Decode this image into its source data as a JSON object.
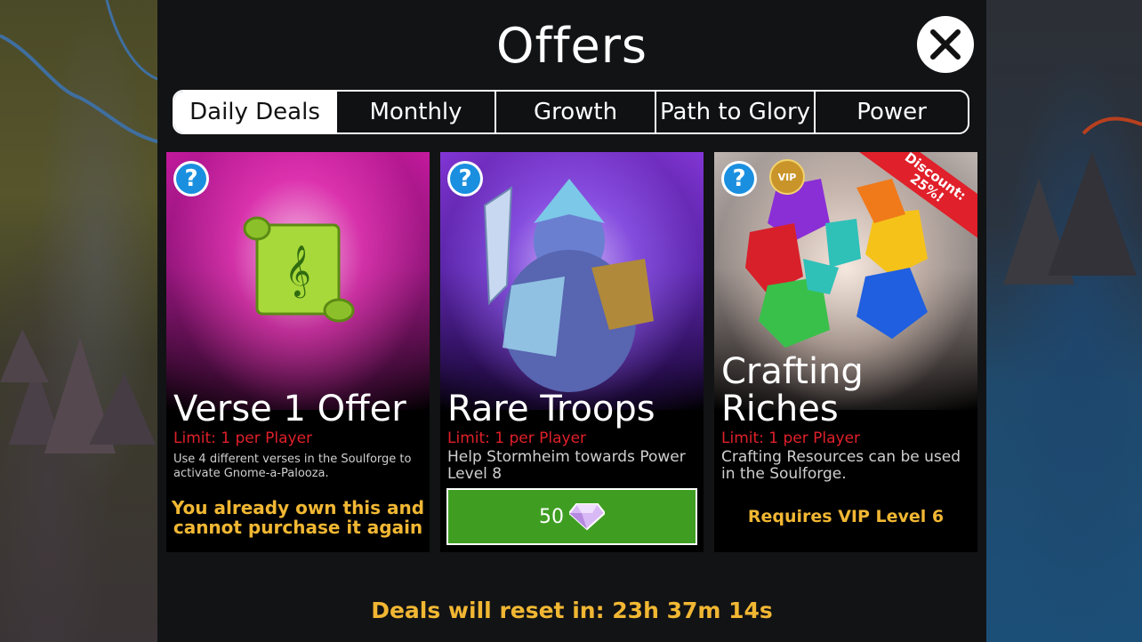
{
  "header": {
    "title": "Offers"
  },
  "tabs": [
    {
      "label": "Daily Deals",
      "active": true
    },
    {
      "label": "Monthly",
      "active": false
    },
    {
      "label": "Growth",
      "active": false
    },
    {
      "label": "Path to Glory",
      "active": false
    },
    {
      "label": "Power",
      "active": false
    }
  ],
  "offers": [
    {
      "title": "Verse 1 Offer",
      "limit": "Limit: 1 per Player",
      "description": "Use 4 different verses in the Soulforge to activate Gnome-a-Palooza.",
      "status_line1": "You already own this and",
      "status_line2": "cannot purchase it again",
      "art_icon": "scroll-icon"
    },
    {
      "title": "Rare Troops",
      "limit": "Limit: 1 per Player",
      "description": "Help Stormheim towards Power Level 8",
      "price": "50",
      "price_icon": "gem-icon",
      "art_icon": "warrior-icon"
    },
    {
      "title_line1": "Crafting",
      "title_line2": "Riches",
      "limit": "Limit: 1 per Player",
      "description": "Crafting Resources can be used in the Soulforge.",
      "requirement": "Requires VIP Level 6",
      "discount_line1": "Discount:",
      "discount_line2": "25%!",
      "vip_badge": "VIP",
      "art_icon": "gems-icon"
    }
  ],
  "footer": {
    "reset_text": "Deals will reset in: 23h 37m 14s"
  },
  "colors": {
    "panel": "#121315",
    "accent_gold": "#f1b733",
    "limit_red": "#e0202a",
    "buy_green": "#3f9e22",
    "help_blue": "#1a8fe0"
  }
}
